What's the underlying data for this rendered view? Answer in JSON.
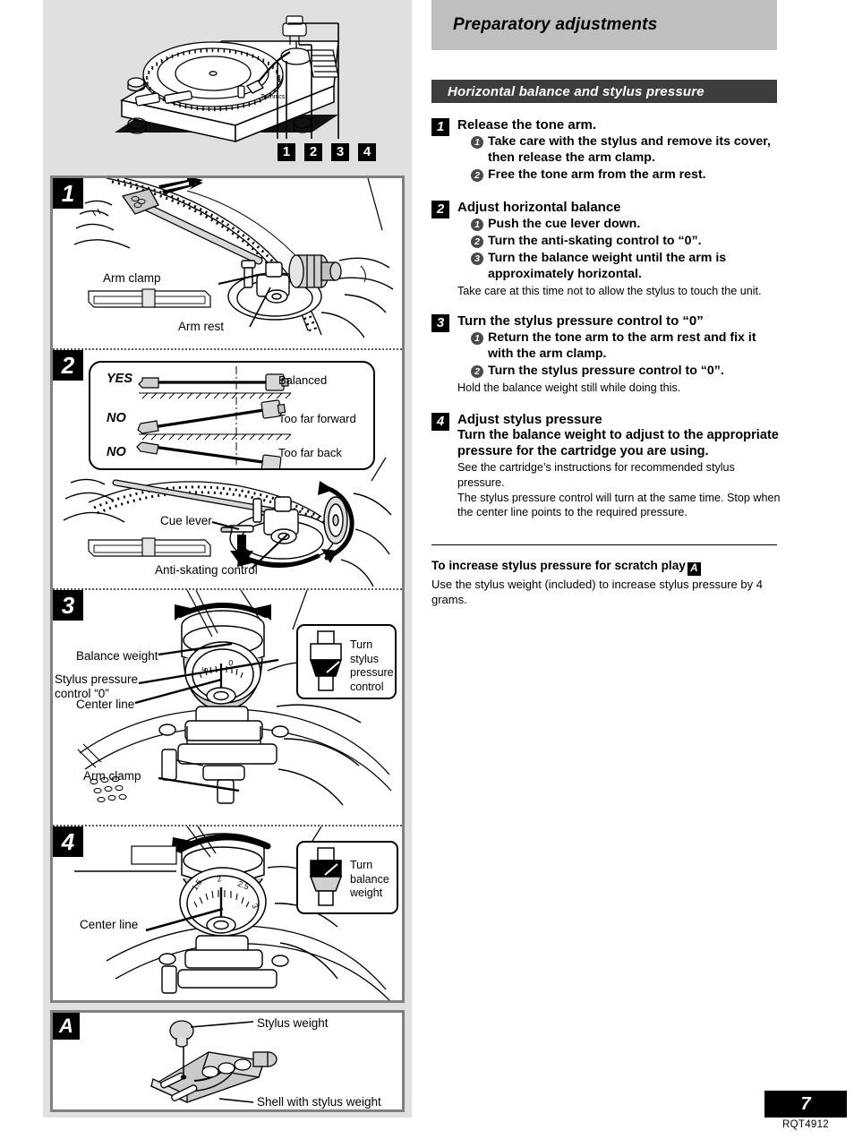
{
  "header": {
    "title": "Preparatory adjustments",
    "section_title": "Horizontal balance and stylus pressure",
    "title_bg": "#bfbfbf",
    "section_bg": "#3d3d3d"
  },
  "steps": [
    {
      "num": "1",
      "heading": "Release the tone arm.",
      "subs": [
        {
          "n": "1",
          "text": "Take care with the stylus and remove its cover, then release the arm clamp."
        },
        {
          "n": "2",
          "text": "Free the tone arm from the arm rest."
        }
      ],
      "note": ""
    },
    {
      "num": "2",
      "heading": "Adjust horizontal balance",
      "subs": [
        {
          "n": "1",
          "text": "Push the cue lever down."
        },
        {
          "n": "2",
          "text": "Turn the anti-skating control to “0”."
        },
        {
          "n": "3",
          "text": "Turn the balance weight until the arm is approximately horizontal."
        }
      ],
      "note": "Take care at this time not to allow the stylus to touch the unit."
    },
    {
      "num": "3",
      "heading": "Turn the stylus pressure control to “0”",
      "subs": [
        {
          "n": "1",
          "text": "Return the tone arm to the arm rest and fix it with the arm clamp."
        },
        {
          "n": "2",
          "text": "Turn the stylus pressure control to “0”."
        }
      ],
      "note": "Hold the balance weight still while doing this."
    },
    {
      "num": "4",
      "heading": "Adjust stylus pressure",
      "bold_body": "Turn the balance weight to adjust to the appropriate pressure for the cartridge you are using.",
      "subs": [],
      "notes": [
        "See the cartridge’s instructions for recommended stylus pressure.",
        "The stylus pressure control will turn at the same time. Stop when the center line points to the required pressure."
      ]
    }
  ],
  "extra": {
    "heading": "To increase stylus pressure for scratch play",
    "heading_badge": "A",
    "body": "Use the stylus weight (included) to increase stylus pressure by 4 grams."
  },
  "illustrations": {
    "overview": {
      "brand": "Technics",
      "callouts": [
        "1",
        "2",
        "3",
        "4"
      ]
    },
    "panel1": {
      "badge": "1",
      "labels": [
        "Arm clamp",
        "Arm rest"
      ]
    },
    "panel2": {
      "badge": "2",
      "balance_box": {
        "rows": [
          {
            "verdict": "YES",
            "caption": "Balanced"
          },
          {
            "verdict": "NO",
            "caption": "Too far forward"
          },
          {
            "verdict": "NO",
            "caption": "Too far back"
          }
        ]
      },
      "labels": [
        "Cue lever",
        "Anti-skating control"
      ]
    },
    "panel3": {
      "badge": "3",
      "labels": [
        "Balance weight",
        "Stylus pressure control “0”",
        "Center line",
        "Arm clamp"
      ],
      "inset_text": "Turn stylus pressure control",
      "dial_marks": [
        "5",
        "0"
      ]
    },
    "panel4": {
      "badge": "4",
      "labels": [
        "Center line"
      ],
      "inset_text": "Turn balance weight",
      "dial_marks": [
        "2",
        "2.5",
        "3",
        "1.5"
      ]
    },
    "panelA": {
      "badge": "A",
      "labels": [
        "Stylus weight",
        "Shell with stylus weight"
      ]
    }
  },
  "footer": {
    "page_number": "7",
    "doc_code": "RQT4912"
  }
}
